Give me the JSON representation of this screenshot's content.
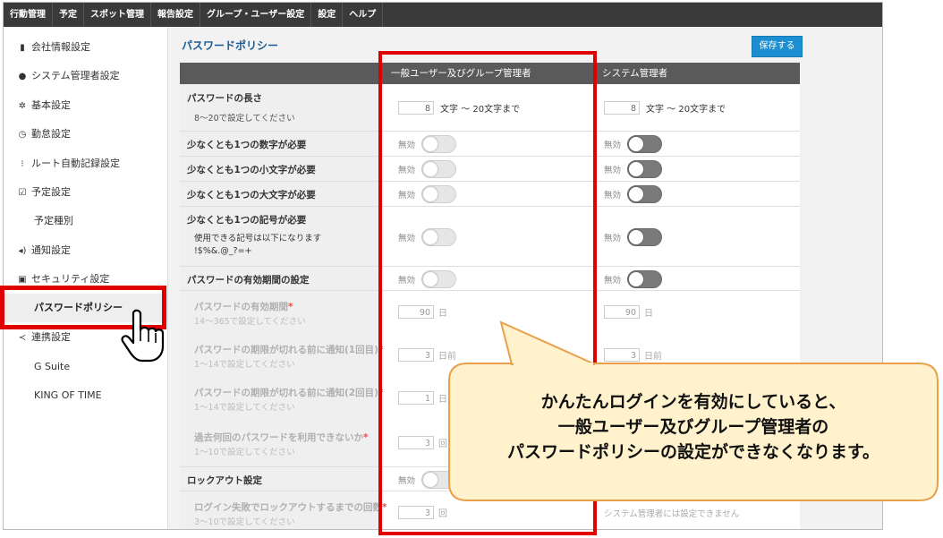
{
  "topnav": [
    "行動管理",
    "予定",
    "スポット管理",
    "報告設定",
    "グループ・ユーザー設定",
    "設定",
    "ヘルプ"
  ],
  "sidebar": {
    "items": [
      {
        "icon": "building-icon",
        "glyph": "▮",
        "label": "会社情報設定"
      },
      {
        "icon": "user-icon",
        "glyph": "●",
        "label": "システム管理者設定"
      },
      {
        "icon": "gear-icon",
        "glyph": "✲",
        "label": "基本設定"
      },
      {
        "icon": "clock-icon",
        "glyph": "◷",
        "label": "勤怠設定"
      },
      {
        "icon": "footprints-icon",
        "glyph": "⁝",
        "label": "ルート自動記録設定"
      },
      {
        "icon": "calendar-icon",
        "glyph": "☑",
        "label": "予定設定"
      },
      {
        "icon": "",
        "glyph": "",
        "label": "予定種別"
      },
      {
        "icon": "speaker-icon",
        "glyph": "◂)",
        "label": "通知設定"
      },
      {
        "icon": "lock-icon",
        "glyph": "▣",
        "label": "セキュリティ設定"
      },
      {
        "icon": "",
        "glyph": "",
        "label": "パスワードポリシー"
      },
      {
        "icon": "share-icon",
        "glyph": "≺",
        "label": "連携設定"
      },
      {
        "icon": "",
        "glyph": "",
        "label": "G Suite"
      },
      {
        "icon": "",
        "glyph": "",
        "label": "KING OF TIME"
      }
    ]
  },
  "main": {
    "title": "パスワードポリシー",
    "save_label": "保存する",
    "col1_header": "一般ユーザー及びグループ管理者",
    "col2_header": "システム管理者",
    "toggle_label": "無効",
    "rows": {
      "length": {
        "title": "パスワードの長さ",
        "sub": "8〜20で設定してください",
        "val1": "8",
        "val2": "8",
        "unit": "文字 〜 20文字まで"
      },
      "digit": {
        "title": "少なくとも1つの数字が必要"
      },
      "lower": {
        "title": "少なくとも1つの小文字が必要"
      },
      "upper": {
        "title": "少なくとも1つの大文字が必要"
      },
      "symbol": {
        "title": "少なくとも1つの記号が必要",
        "sub1": "使用できる記号は以下になります",
        "sub2": "!$%&.@_?=+"
      },
      "expiry": {
        "title": "パスワードの有効期間の設定"
      },
      "expiry_days": {
        "title": "パスワードの有効期間",
        "sub": "14〜365で設定してください",
        "val1": "90",
        "val2": "90",
        "unit": "日"
      },
      "notify1": {
        "title": "パスワードの期限が切れる前に通知(1回目)",
        "sub": "1〜14で設定してください",
        "val1": "3",
        "val2": "3",
        "unit": "日前"
      },
      "notify2": {
        "title": "パスワードの期限が切れる前に通知(2回目)",
        "sub": "1〜14で設定してください",
        "val1": "1",
        "unit": "日"
      },
      "history": {
        "title": "過去何回のパスワードを利用できないか",
        "sub": "1〜10で設定してください",
        "val1": "3",
        "unit": "回"
      },
      "lockout": {
        "title": "ロックアウト設定"
      },
      "lockout_count": {
        "title": "ログイン失敗でロックアウトするまでの回数",
        "sub": "3〜10で設定してください",
        "val1": "3",
        "unit": "回",
        "col2_note": "システム管理者には設定できません"
      }
    }
  },
  "callout": {
    "line1": "かんたんログインを有効にしていると、",
    "line2": "一般ユーザー及びグループ管理者の",
    "line3": "パスワードポリシーの設定ができなくなります。"
  },
  "colors": {
    "accent": "#1b8fd1",
    "highlight": "#e00000",
    "callout_fill": "#fff2cc",
    "callout_border": "#e8a04a"
  }
}
